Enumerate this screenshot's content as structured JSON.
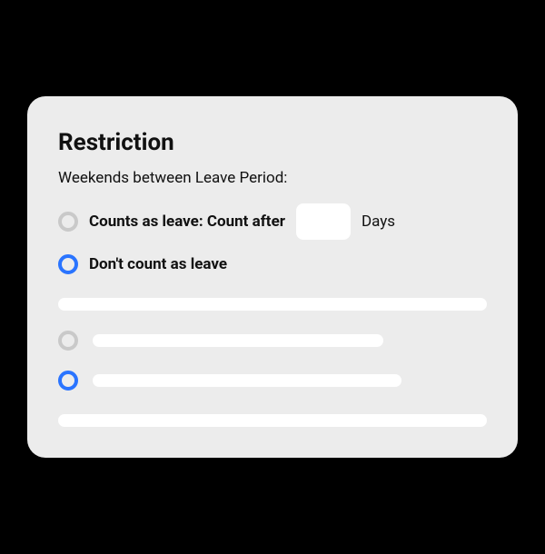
{
  "card": {
    "title": "Restriction",
    "subtitle": "Weekends between Leave Period:",
    "options": {
      "counts": {
        "label_prefix": "Counts as leave: Count after",
        "days_value": "",
        "days_suffix": "Days",
        "selected": false
      },
      "dont_count": {
        "label": "Don't count as leave",
        "selected": true
      }
    }
  }
}
